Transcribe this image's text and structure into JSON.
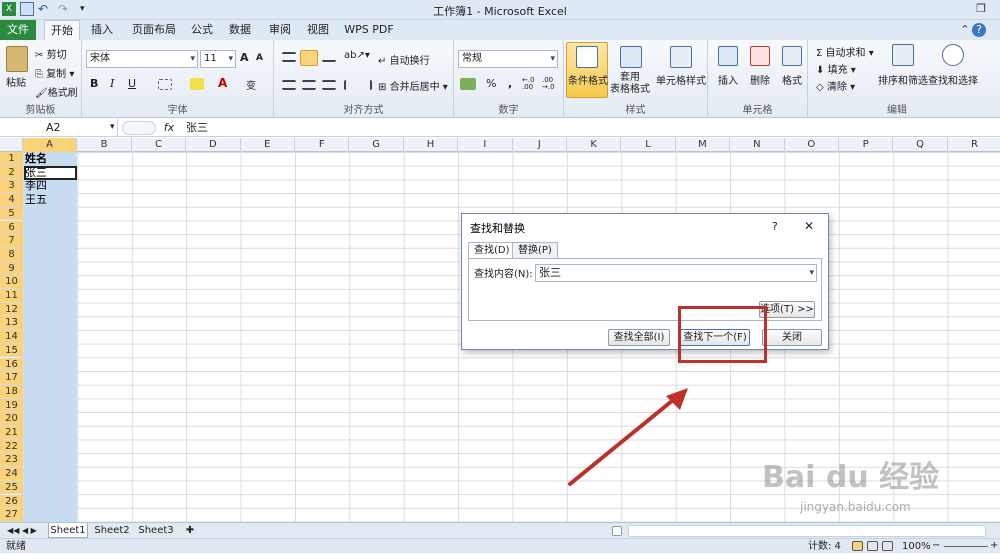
{
  "window": {
    "title": "工作簿1 - Microsoft Excel"
  },
  "tabs": [
    "文件",
    "开始",
    "插入",
    "页面布局",
    "公式",
    "数据",
    "审阅",
    "视图",
    "WPS PDF"
  ],
  "ribbon": {
    "clipboard": {
      "label": "剪贴板",
      "paste": "粘贴",
      "cut": "剪切",
      "copy": "复制",
      "format_painter": "格式刷"
    },
    "font": {
      "label": "字体",
      "family": "宋体",
      "size": "11",
      "bold": "B",
      "italic": "I",
      "underline": "U",
      "grow": "A",
      "shrink": "A",
      "font_color_letter": "A",
      "phonetic": "变"
    },
    "alignment": {
      "label": "对齐方式",
      "wrap": "自动换行",
      "merge": "合并后居中"
    },
    "number": {
      "label": "数字",
      "format": "常规",
      "percent": "%",
      "comma": ",",
      "inc": "←.0 .00",
      "dec": ".00 →.0"
    },
    "styles": {
      "label": "样式",
      "conditional": "条件格式",
      "table": "套用\n表格格式",
      "cell_styles": "单元格样式"
    },
    "cells": {
      "label": "单元格",
      "insert": "插入",
      "delete": "删除",
      "format": "格式"
    },
    "editing": {
      "label": "编辑",
      "autosum": "自动求和",
      "fill": "填充",
      "clear": "清除",
      "sort": "排序和筛选",
      "find": "查找和选择"
    }
  },
  "formula_bar": {
    "name_box": "A2",
    "fx": "fx",
    "value": "张三"
  },
  "columns": [
    "A",
    "B",
    "C",
    "D",
    "E",
    "F",
    "G",
    "H",
    "I",
    "J",
    "K",
    "L",
    "M",
    "N",
    "O",
    "P",
    "Q",
    "R"
  ],
  "rows": [
    "1",
    "2",
    "3",
    "4",
    "5",
    "6",
    "7",
    "8",
    "9",
    "10",
    "11",
    "12",
    "13",
    "14",
    "15",
    "16",
    "17",
    "18",
    "19",
    "20",
    "21",
    "22",
    "23",
    "24",
    "25",
    "26",
    "27"
  ],
  "cells": {
    "A1": "姓名",
    "A2": "张三",
    "A3": "李四",
    "A4": "王五"
  },
  "sheets": [
    "Sheet1",
    "Sheet2",
    "Sheet3"
  ],
  "status": {
    "ready": "就绪",
    "count": "计数: 4",
    "zoom": "100%",
    "minus": "−",
    "plus": "+"
  },
  "dialog": {
    "title": "查找和替换",
    "help": "?",
    "close_x": "✕",
    "tab_find": "查找(D)",
    "tab_replace": "替换(P)",
    "find_label": "查找内容(N):",
    "find_value": "张三",
    "options": "选项(T) >>",
    "find_all": "查找全部(I)",
    "find_next": "查找下一个(F)",
    "close": "关闭"
  },
  "watermark": {
    "text": "Bai du 经验",
    "url": "jingyan.baidu.com"
  },
  "colors": {
    "highlight": "#c0302a",
    "file_tab": "#2a8a3e",
    "selected_header": "#f9d27a",
    "selection": "#c7dcf1"
  }
}
